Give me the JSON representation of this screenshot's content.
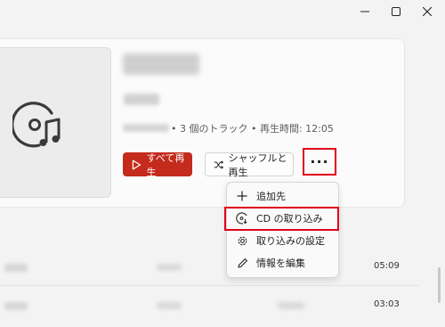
{
  "window": {
    "minimize_icon": "minimize-icon",
    "maximize_icon": "maximize-icon",
    "close_icon": "close-icon"
  },
  "album": {
    "art_icon": "cd-music-icon",
    "meta": "• 3 個のトラック • 再生時間: 12:05"
  },
  "actions": {
    "play_all": "すべて再生",
    "shuffle_play": "シャッフルと再生",
    "more": "···"
  },
  "context_menu": {
    "items": [
      {
        "label": "追加先",
        "icon": "plus-icon"
      },
      {
        "label": "CD の取り込み",
        "icon": "cd-rip-icon"
      },
      {
        "label": "取り込みの設定",
        "icon": "gear-icon"
      },
      {
        "label": "情報を編集",
        "icon": "pencil-icon"
      }
    ]
  },
  "tracks": [
    {
      "duration": "05:09"
    },
    {
      "duration": "03:03"
    }
  ],
  "colors": {
    "accent": "#c42b1c",
    "highlight": "#e0001b"
  }
}
